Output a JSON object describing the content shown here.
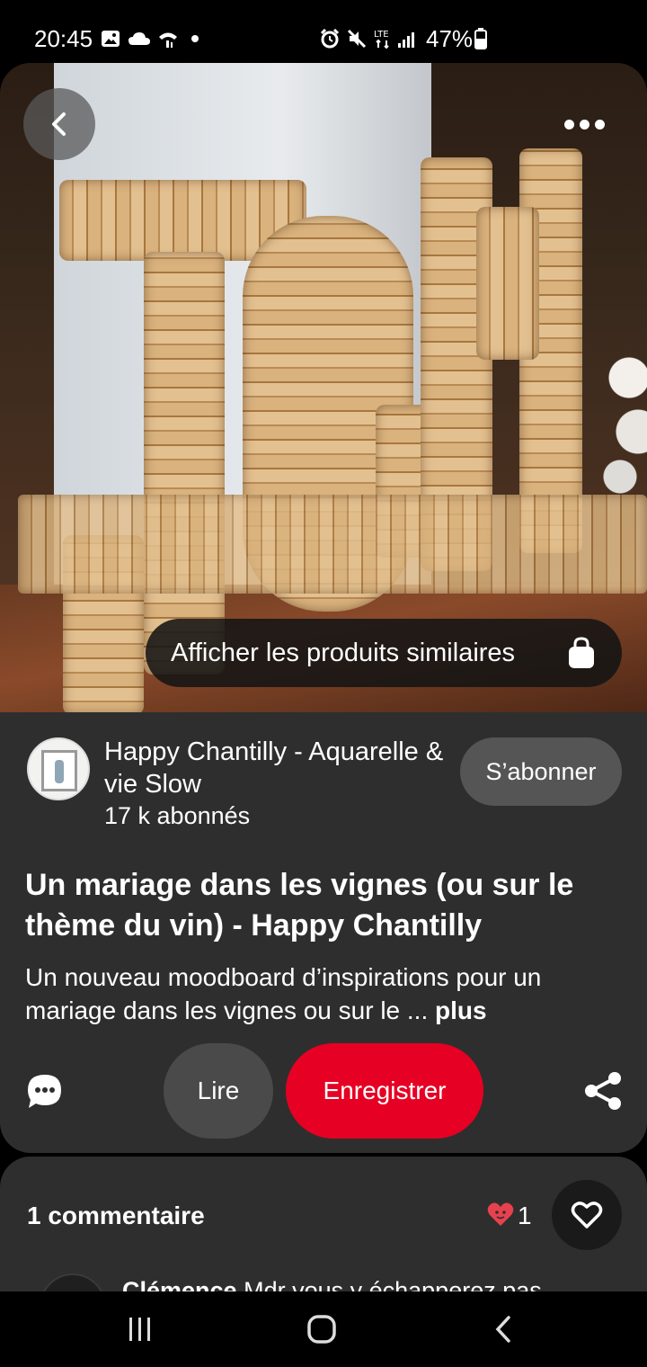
{
  "status_bar": {
    "time": "20:45",
    "battery": "47%",
    "icons": [
      "gallery-icon",
      "cloud-icon",
      "wifi-icon",
      "notification-dot-icon",
      "alarm-icon",
      "mute-icon",
      "lte-icon",
      "signal-icon",
      "battery-icon"
    ]
  },
  "hero": {
    "similar_products_label": "Afficher les produits similaires"
  },
  "author": {
    "name": "Happy Chantilly - Aquarelle & vie Slow",
    "followers": "17 k abonnés",
    "subscribe_label": "S’abonner"
  },
  "pin": {
    "title": "Un mariage dans les vignes (ou sur le thème du vin) - Happy Chantilly",
    "description": "Un nouveau moodboard d’inspirations pour un mariage dans les vignes ou sur le ... ",
    "more_label": "plus"
  },
  "actions": {
    "read_label": "Lire",
    "save_label": "Enregistrer"
  },
  "comments": {
    "title": "1 commentaire",
    "reaction_count": "1",
    "preview_author": "Clémence",
    "preview_text": " Mdr vous y échapperez pas"
  },
  "colors": {
    "save_red": "#e60023",
    "panel_bg": "#2e2e2e",
    "reaction_red": "#e8414e"
  }
}
